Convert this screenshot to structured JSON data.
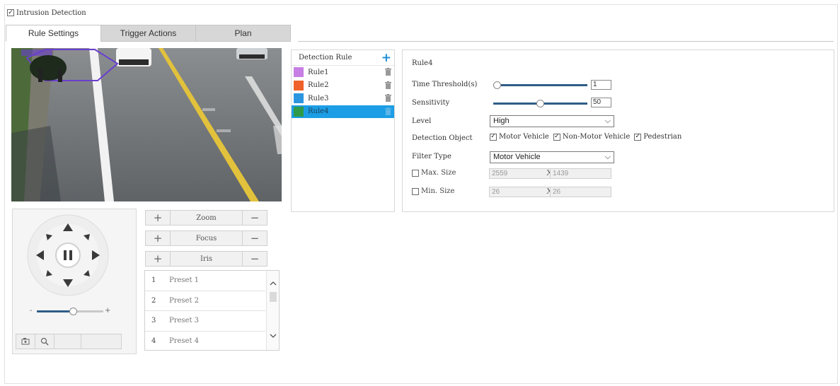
{
  "intrusion_detection": {
    "label": "Intrusion Detection",
    "checked": true
  },
  "tabs": [
    {
      "label": "Rule Settings",
      "active": true
    },
    {
      "label": "Trigger Actions",
      "active": false
    },
    {
      "label": "Plan",
      "active": false
    }
  ],
  "ptz": {
    "zoom_label": "Zoom",
    "focus_label": "Focus",
    "iris_label": "Iris",
    "plus_symbol": "+",
    "minus_symbol": "−",
    "speed_min": "-",
    "speed_max": "+",
    "speed_level": 0.55
  },
  "presets": [
    {
      "num": "1",
      "name": "Preset 1"
    },
    {
      "num": "2",
      "name": "Preset 2"
    },
    {
      "num": "3",
      "name": "Preset 3"
    },
    {
      "num": "4",
      "name": "Preset 4"
    }
  ],
  "rules": {
    "header": "Detection Rule",
    "add_symbol": "+",
    "items": [
      {
        "label": "Rule1",
        "color": "#c77fe6",
        "selected": false
      },
      {
        "label": "Rule2",
        "color": "#f0602a",
        "selected": false
      },
      {
        "label": "Rule3",
        "color": "#2b95e0",
        "selected": false
      },
      {
        "label": "Rule4",
        "color": "#2e9a4a",
        "selected": true
      }
    ]
  },
  "config": {
    "title": "Rule4",
    "time_threshold_label": "Time Threshold(s)",
    "time_threshold_value": "1",
    "time_threshold_level": 0.0,
    "sensitivity_label": "Sensitivity",
    "sensitivity_value": "50",
    "sensitivity_level": 0.5,
    "level_label": "Level",
    "level_value": "High",
    "detection_object_label": "Detection Object",
    "objects": [
      {
        "label": "Motor Vehicle",
        "checked": true
      },
      {
        "label": "Non-Motor Vehicle",
        "checked": true
      },
      {
        "label": "Pedestrian",
        "checked": true
      }
    ],
    "filter_type_label": "Filter Type",
    "filter_type_value": "Motor Vehicle",
    "max_size_label": "Max. Size",
    "max_w": "2559",
    "max_h": "1439",
    "min_size_label": "Min. Size",
    "min_w": "26",
    "min_h": "26",
    "x_sep": "X"
  },
  "colors": {
    "selected_row": "#1c9ee6",
    "slider_fill": "#2e5d87",
    "region_outline": "#6a3fcf"
  }
}
